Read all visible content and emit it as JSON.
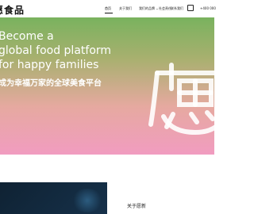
{
  "header": {
    "logo_text": "愿食品",
    "nav": [
      {
        "label": "首页"
      },
      {
        "label": "关于我们"
      },
      {
        "label": "我们的品牌 ⌄"
      },
      {
        "label": "社会责任"
      },
      {
        "label": "联系我们"
      }
    ],
    "phone": "+400 000"
  },
  "hero": {
    "lines": [
      "Become a",
      "global food platform",
      "for happy families"
    ],
    "chinese_tagline": "成为幸福万家的全球美食平台",
    "watermark_char": "愿"
  },
  "section2": {
    "about_title": "关于愿新"
  }
}
